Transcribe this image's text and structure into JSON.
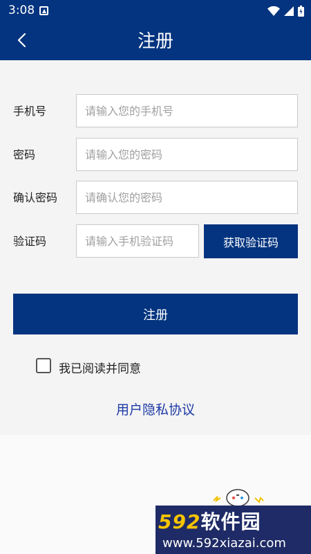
{
  "status_bar": {
    "time": "3:08",
    "icons": [
      "notification-a-icon",
      "wifi-icon",
      "signal-icon",
      "battery-icon"
    ]
  },
  "header": {
    "title": "注册",
    "back_icon": "back-arrow-icon"
  },
  "form": {
    "phone": {
      "label": "手机号",
      "placeholder": "请输入您的手机号",
      "value": ""
    },
    "password": {
      "label": "密码",
      "placeholder": "请输入您的密码",
      "value": ""
    },
    "confirm_password": {
      "label": "确认密码",
      "placeholder": "请确认您的密码",
      "value": ""
    },
    "verification": {
      "label": "验证码",
      "placeholder": "请输入手机验证码",
      "value": ""
    },
    "get_code_label": "获取验证码"
  },
  "register_label": "注册",
  "agreement": {
    "checked": false,
    "label": "我已阅读并同意",
    "link": "用户隐私协议"
  },
  "watermark": {
    "prefix": "592",
    "name": "软件园",
    "url": "www.592xiazai.com"
  },
  "colors": {
    "primary": "#04347f",
    "link": "#1d3aa5",
    "background": "#f4f4f4"
  }
}
